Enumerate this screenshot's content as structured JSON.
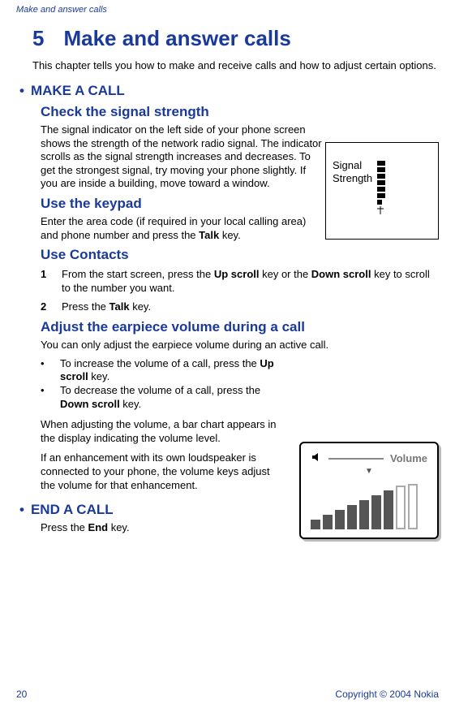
{
  "header": {
    "running": "Make and answer calls"
  },
  "chapter": {
    "number": "5",
    "title": "Make and answer calls"
  },
  "intro": "This chapter tells you how to make and receive calls and how to adjust certain options.",
  "sectionA": {
    "title": "MAKE A CALL"
  },
  "sub1": {
    "title": "Check the signal strength",
    "text": "The signal indicator on the left side of your phone screen shows the strength of the network radio signal. The indicator scrolls as the signal strength increases and decreases. To get the strongest signal, try moving your phone slightly. If you are inside a building, move toward a window."
  },
  "signal_figure": {
    "label1": "Signal",
    "label2": "Strength"
  },
  "sub2": {
    "title": "Use the keypad",
    "text_pre": "Enter the area code (if required in your local calling area) and phone number and press the ",
    "text_bold": "Talk",
    "text_post": " key."
  },
  "sub3": {
    "title": "Use Contacts",
    "step1": {
      "num": "1",
      "pre": "From the start screen, press the ",
      "b1": "Up scroll",
      "mid": " key or the ",
      "b2": "Down scroll",
      "post": " key to scroll to the number you want."
    },
    "step2": {
      "num": "2",
      "pre": "Press the ",
      "b1": "Talk",
      "post": " key."
    }
  },
  "sub4": {
    "title": "Adjust the earpiece volume during a call",
    "lead": "You can only adjust the earpiece volume during an active call.",
    "bullet1": {
      "pre": "To increase the volume of a call, press the ",
      "b": "Up scroll",
      "post": " key."
    },
    "bullet2": {
      "pre": "To decrease the volume of a call, press the ",
      "b": "Down scroll",
      "post": " key."
    },
    "para1": "When adjusting the volume, a bar chart appears in the display indicating the volume level.",
    "para2": "If an enhancement with its own loudspeaker is connected to your phone, the volume keys adjust the volume for that enhancement."
  },
  "volume_figure": {
    "label": "Volume"
  },
  "sectionB": {
    "title": "END A CALL",
    "text_pre": "Press the ",
    "text_bold": "End",
    "text_post": " key."
  },
  "footer": {
    "page": "20",
    "copyright": "Copyright © 2004 Nokia"
  }
}
